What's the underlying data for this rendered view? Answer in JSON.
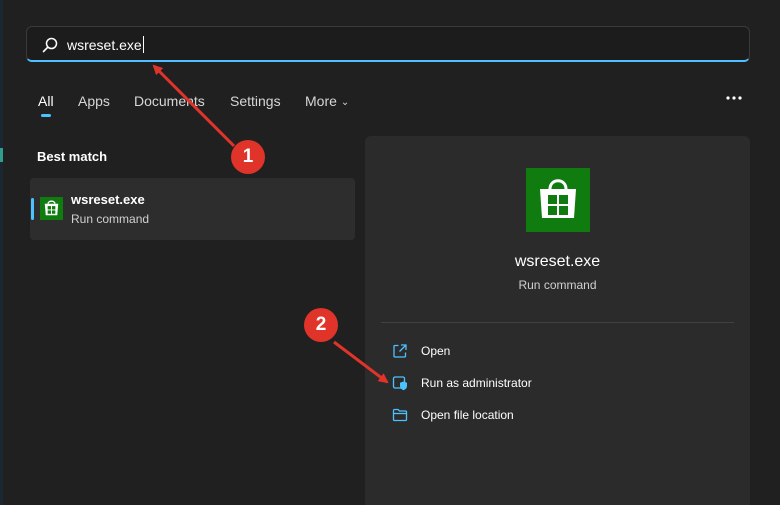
{
  "search": {
    "value": "wsreset.exe"
  },
  "tabs": [
    {
      "label": "All",
      "active": true
    },
    {
      "label": "Apps"
    },
    {
      "label": "Documents"
    },
    {
      "label": "Settings"
    },
    {
      "label": "More"
    }
  ],
  "best_match": {
    "section_label": "Best match",
    "title": "wsreset.exe",
    "subtitle": "Run command"
  },
  "detail": {
    "title": "wsreset.exe",
    "subtitle": "Run command",
    "actions": [
      {
        "label": "Open",
        "icon": "open-external-icon"
      },
      {
        "label": "Run as administrator",
        "icon": "shield-admin-icon"
      },
      {
        "label": "Open file location",
        "icon": "folder-icon"
      }
    ]
  },
  "annotations": [
    {
      "label": "1"
    },
    {
      "label": "2"
    }
  ],
  "colors": {
    "background": "#202020",
    "accent": "#4cc2ff",
    "store_green": "#107c10",
    "annotation_red": "#e0342a"
  }
}
